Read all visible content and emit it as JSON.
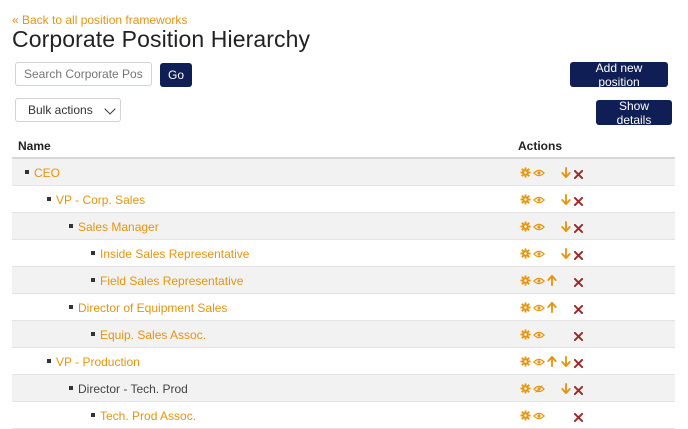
{
  "nav": {
    "back_link": "« Back to all position frameworks"
  },
  "page": {
    "title": "Corporate Position Hierarchy"
  },
  "search": {
    "placeholder": "Search Corporate Position",
    "go_label": "Go"
  },
  "toolbar": {
    "add_new_label": "Add new position",
    "show_details_label": "Show details",
    "bulk_actions_label": "Bulk actions"
  },
  "table": {
    "headers": {
      "name": "Name",
      "actions": "Actions"
    },
    "rows": [
      {
        "name": "CEO",
        "level": 0,
        "link": true,
        "up": false,
        "down": true,
        "eye_muted": false
      },
      {
        "name": "VP - Corp. Sales",
        "level": 1,
        "link": true,
        "up": false,
        "down": true,
        "eye_muted": false
      },
      {
        "name": "Sales Manager",
        "level": 2,
        "link": true,
        "up": false,
        "down": true,
        "eye_muted": false
      },
      {
        "name": "Inside Sales Representative",
        "level": 3,
        "link": true,
        "up": false,
        "down": true,
        "eye_muted": false
      },
      {
        "name": "Field Sales Representative",
        "level": 3,
        "link": true,
        "up": true,
        "down": false,
        "eye_muted": false
      },
      {
        "name": "Director of Equipment Sales",
        "level": 2,
        "link": true,
        "up": true,
        "down": false,
        "eye_muted": false
      },
      {
        "name": "Equip. Sales Assoc.",
        "level": 3,
        "link": true,
        "up": false,
        "down": false,
        "eye_muted": false
      },
      {
        "name": "VP - Production",
        "level": 1,
        "link": true,
        "up": true,
        "down": true,
        "eye_muted": false
      },
      {
        "name": "Director - Tech. Prod",
        "level": 2,
        "link": false,
        "up": false,
        "down": true,
        "eye_muted": true
      },
      {
        "name": "Tech. Prod Assoc.",
        "level": 3,
        "link": true,
        "up": false,
        "down": false,
        "eye_muted": false
      }
    ]
  },
  "colors": {
    "accent": "#e8930c",
    "button": "#0f1e54",
    "delete": "#9a2b2b"
  },
  "icons": {
    "settings": "gear-icon",
    "view": "eye-icon",
    "move_up": "arrow-up-icon",
    "move_down": "arrow-down-icon",
    "delete": "delete-x-icon"
  }
}
